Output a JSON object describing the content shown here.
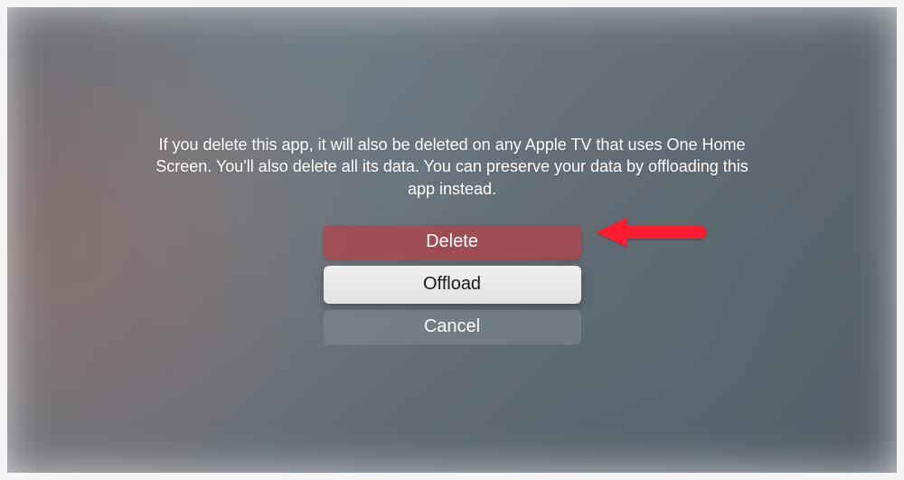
{
  "dialog": {
    "message": "If you delete this app, it will also be deleted on any Apple TV that uses One Home Screen. You'll also delete all its data. You can preserve your data by offloading this app instead.",
    "buttons": {
      "delete": "Delete",
      "offload": "Offload",
      "cancel": "Cancel"
    }
  },
  "annotation": {
    "arrow_color": "#ff1a2e"
  }
}
